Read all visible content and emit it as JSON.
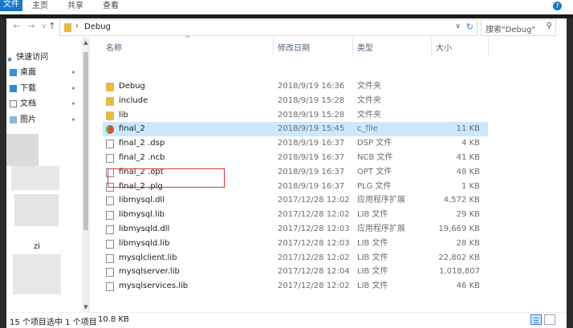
{
  "ribbon": {
    "file_tab": "文件",
    "tabs": [
      "主页",
      "共享",
      "查看"
    ]
  },
  "address": {
    "path": "Debug",
    "search_placeholder": "搜索\"Debug\""
  },
  "nav": {
    "quick_access": "快速访问",
    "items": [
      {
        "label": "桌面",
        "icon": "desktop-icon"
      },
      {
        "label": "下载",
        "icon": "download-icon"
      },
      {
        "label": "文档",
        "icon": "document-icon"
      },
      {
        "label": "图片",
        "icon": "picture-icon"
      }
    ],
    "partial_label": "zi"
  },
  "columns": {
    "name": "名称",
    "date": "修改日期",
    "type": "类型",
    "size": "大小"
  },
  "files": [
    {
      "name": "Debug",
      "date": "2018/9/19 16:36",
      "type": "文件夹",
      "size": "",
      "icon": "folder"
    },
    {
      "name": "include",
      "date": "2018/9/19 15:28",
      "type": "文件夹",
      "size": "",
      "icon": "folder"
    },
    {
      "name": "lib",
      "date": "2018/9/19 15:28",
      "type": "文件夹",
      "size": "",
      "icon": "folder"
    },
    {
      "name": "final_2",
      "date": "2018/9/19 15:45",
      "type": "c_file",
      "size": "11 KB",
      "icon": "exe"
    },
    {
      "name": "final_2 .dsp",
      "date": "2018/9/19 16:37",
      "type": "DSP 文件",
      "size": "4 KB",
      "icon": "doc"
    },
    {
      "name": "final_2 .ncb",
      "date": "2018/9/19 16:37",
      "type": "NCB 文件",
      "size": "41 KB",
      "icon": "doc"
    },
    {
      "name": "final_2 .opt",
      "date": "2018/9/19 16:37",
      "type": "OPT 文件",
      "size": "48 KB",
      "icon": "doc"
    },
    {
      "name": "final_2 .plg",
      "date": "2018/9/19 16:37",
      "type": "PLG 文件",
      "size": "1 KB",
      "icon": "doc"
    },
    {
      "name": "libmysql.dll",
      "date": "2017/12/28 12:02",
      "type": "应用程序扩展",
      "size": "4,572 KB",
      "icon": "doc"
    },
    {
      "name": "libmysql.lib",
      "date": "2017/12/28 12:02",
      "type": "LIB 文件",
      "size": "29 KB",
      "icon": "doc"
    },
    {
      "name": "libmysqld.dll",
      "date": "2017/12/28 12:03",
      "type": "应用程序扩展",
      "size": "19,669 KB",
      "icon": "doc"
    },
    {
      "name": "libmysqld.lib",
      "date": "2017/12/28 12:03",
      "type": "LIB 文件",
      "size": "28 KB",
      "icon": "doc"
    },
    {
      "name": "mysqlclient.lib",
      "date": "2017/12/28 12:02",
      "type": "LIB 文件",
      "size": "22,802 KB",
      "icon": "doc"
    },
    {
      "name": "mysqlserver.lib",
      "date": "2017/12/28 12:04",
      "type": "LIB 文件",
      "size": "1,018,807",
      "icon": "doc"
    },
    {
      "name": "mysqlservices.lib",
      "date": "2017/12/28 12:02",
      "type": "LIB 文件",
      "size": "46 KB",
      "icon": "doc"
    }
  ],
  "status": {
    "count": "15 个项目",
    "selected": "选中 1 个项目",
    "size": "10.8 KB"
  },
  "colors": {
    "accent": "#1979ca",
    "folder": "#e8b84a",
    "highlight": "#d9363e",
    "selected": "#cce8ff"
  }
}
